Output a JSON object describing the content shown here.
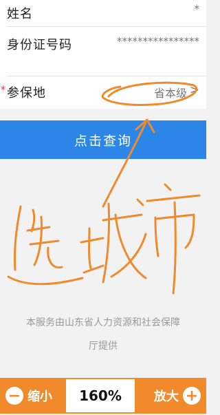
{
  "form": {
    "name": {
      "label": "姓名",
      "value": "*"
    },
    "id_number": {
      "label": "身份证号码",
      "value": "****************"
    },
    "region": {
      "required_mark": "*",
      "label": "参保地",
      "value": "省本级",
      "chevron": ">"
    }
  },
  "query_button": {
    "label": "点击查询"
  },
  "footer": {
    "line1": "本服务由山东省人力资源和社会保障",
    "line2": "厅提供"
  },
  "zoom": {
    "minus": "−",
    "shrink_label": "缩小",
    "value": "160%",
    "grow_label": "放大",
    "plus": "+"
  },
  "annotation": {
    "handwritten_text": "选城市",
    "ink_color": "#f08a2a"
  },
  "colors": {
    "primary": "#2b86e8",
    "zoom_bar": "#f08a2a",
    "required": "#e0383b"
  }
}
